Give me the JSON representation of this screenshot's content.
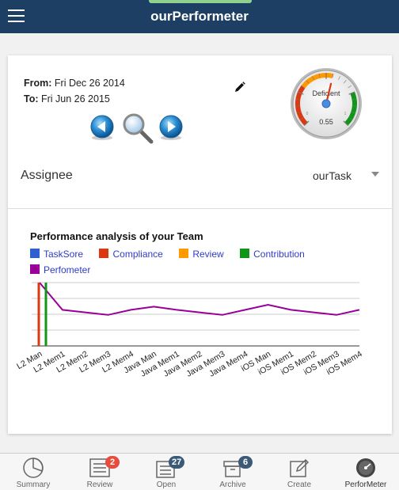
{
  "header": {
    "title": "ourPerformeter"
  },
  "filters": {
    "from_label": "From:",
    "from_value": "Fri Dec 26 2014",
    "to_label": "To:",
    "to_value": "Fri Jun 26 2015"
  },
  "gauge": {
    "label": "Deficient",
    "value": "0.55",
    "fraction": 0.55,
    "min_label": "0",
    "max_label": "1"
  },
  "assignee": {
    "label": "Assignee",
    "selected": "ourTask"
  },
  "chart": {
    "title": "Performance analysis of your Team",
    "legend": [
      {
        "name": "TaskSore",
        "color": "#3060d0"
      },
      {
        "name": "Compliance",
        "color": "#dc3912"
      },
      {
        "name": "Review",
        "color": "#ff9900"
      },
      {
        "name": "Contribution",
        "color": "#109618"
      },
      {
        "name": "Perfometer",
        "color": "#990099"
      }
    ]
  },
  "chart_data": {
    "type": "line",
    "categories": [
      "L2 Man",
      "L2 Mem1",
      "L2 Mem2",
      "L2 Mem3",
      "L2 Mem4",
      "Java Man",
      "Java Mem1",
      "Java Mem2",
      "Java Mem3",
      "Java Mem4",
      "iOS Man",
      "iOS Mem1",
      "iOS Mem2",
      "iOS Mem3",
      "iOS Mem4"
    ],
    "ylim": [
      0,
      1
    ],
    "grid": true,
    "series": [
      {
        "name": "Perfometer",
        "color": "#990099",
        "values": [
          1.0,
          0.57,
          0.53,
          0.49,
          0.57,
          0.62,
          0.57,
          0.53,
          0.49,
          0.57,
          0.65,
          0.57,
          0.53,
          0.49,
          0.57
        ]
      },
      {
        "name": "Compliance",
        "color": "#dc3912",
        "values": [
          1.0,
          null,
          null,
          null,
          null,
          null,
          null,
          null,
          null,
          null,
          null,
          null,
          null,
          null,
          null
        ]
      },
      {
        "name": "Contribution",
        "color": "#109618",
        "values": [
          1.0,
          null,
          null,
          null,
          null,
          null,
          null,
          null,
          null,
          null,
          null,
          null,
          null,
          null,
          null
        ]
      }
    ]
  },
  "tabs": [
    {
      "label": "Summary",
      "icon": "pie-chart-icon",
      "badge": ""
    },
    {
      "label": "Review",
      "icon": "list-icon",
      "badge": "2",
      "badge_color": "#e74c3c"
    },
    {
      "label": "Open",
      "icon": "stack-icon",
      "badge": "27",
      "badge_color": "#3c5a78"
    },
    {
      "label": "Archive",
      "icon": "archive-box-icon",
      "badge": "6",
      "badge_color": "#3c5a78"
    },
    {
      "label": "Create",
      "icon": "pencil-square-icon",
      "badge": ""
    },
    {
      "label": "PerforMeter",
      "icon": "speedometer-icon",
      "badge": ""
    }
  ]
}
